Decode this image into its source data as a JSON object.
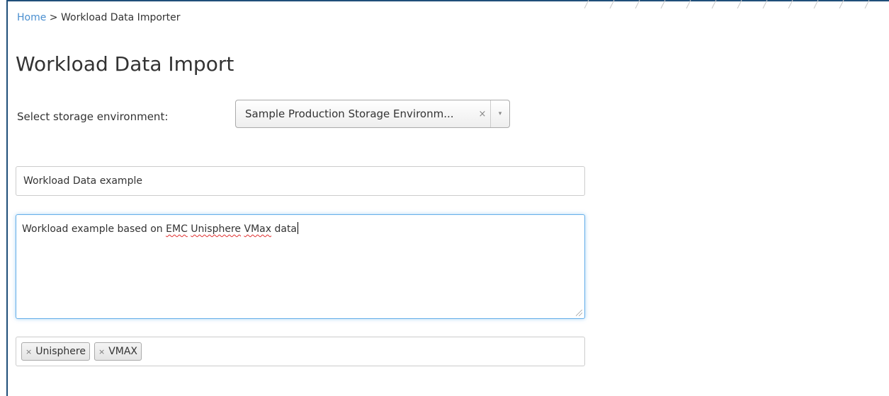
{
  "breadcrumb": {
    "home": "Home",
    "separator": " > ",
    "current": "Workload Data Importer"
  },
  "page": {
    "title": "Workload Data Import"
  },
  "storage_select": {
    "label": "Select storage environment:",
    "value": "Sample Production Storage Environm...",
    "clear_icon": "×",
    "arrow_icon": "▾"
  },
  "name_input": {
    "value": "Workload Data example"
  },
  "description": {
    "part1": "Workload example based on ",
    "word_emc": "EMC",
    "space1": " ",
    "word_unisphere": "Unisphere",
    "space2": " ",
    "word_vmax": "VMax",
    "part2": " data"
  },
  "tags": {
    "remove_icon": "×",
    "items": [
      "Unisphere",
      "VMAX"
    ]
  },
  "colors": {
    "link": "#4a8fd0",
    "focus_border": "#66afe9",
    "frame_border": "#1f4e79",
    "spellcheck": "#e03030"
  },
  "icons": [
    "clear-icon",
    "dropdown-arrow-icon",
    "tag-remove-icon",
    "resize-handle-icon"
  ]
}
